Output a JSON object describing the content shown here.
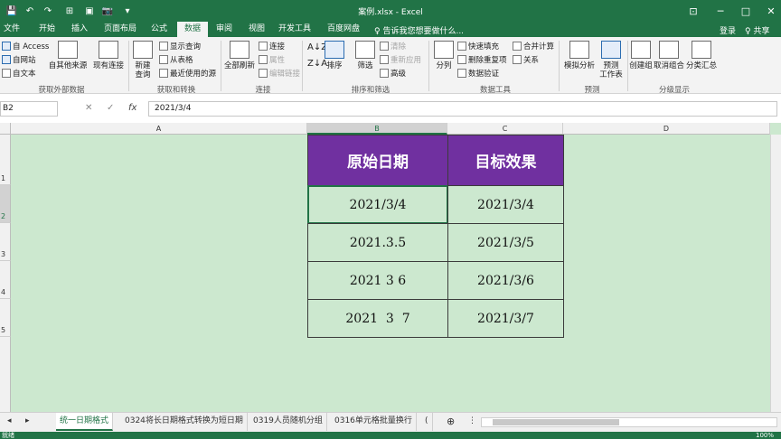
{
  "titlebar": {
    "title": "案例.xlsx - Excel",
    "minimize_icon": "─",
    "restore_icon": "□",
    "close_icon": "✕",
    "ribbon_display_icon": "⊡"
  },
  "quick_access": {
    "save_icon": "💾",
    "undo_icon": "↶",
    "redo_icon": "↷",
    "icons": [
      "⊞",
      "▣",
      "📷",
      "▾"
    ]
  },
  "tabs": [
    {
      "label": "文件"
    },
    {
      "label": "开始"
    },
    {
      "label": "插入"
    },
    {
      "label": "页面布局"
    },
    {
      "label": "公式"
    },
    {
      "label": "数据"
    },
    {
      "label": "审阅"
    },
    {
      "label": "视图"
    },
    {
      "label": "开发工具"
    },
    {
      "label": "百度网盘"
    }
  ],
  "tell_me": "♀ 告诉我您想要做什么...",
  "account": {
    "sign_in": "登录",
    "share": "♀ 共享"
  },
  "ribbon": {
    "get_external": {
      "access": "自 Access",
      "web": "自网站",
      "text": "自文本",
      "other": "自其他来源",
      "existing": "现有连接",
      "label": "获取外部数据"
    },
    "get_transform": {
      "new_query": "新建",
      "new_query2": "查询",
      "show_queries": "显示查询",
      "from_table": "从表格",
      "recent": "最近使用的源",
      "label": "获取和转换"
    },
    "connections": {
      "refresh_all": "全部刷新",
      "connections": "连接",
      "properties": "属性",
      "edit_links": "编辑链接",
      "label": "连接"
    },
    "sort_filter": {
      "sort": "排序",
      "filter": "筛选",
      "clear": "清除",
      "reapply": "重新应用",
      "advanced": "高级",
      "label": "排序和筛选"
    },
    "data_tools": {
      "split": "分列",
      "flash_fill": "快速填充",
      "remove_dup": "删除重复项",
      "validation": "数据验证",
      "consolidate": "合并计算",
      "relations": "关系",
      "label": "数据工具"
    },
    "forecast": {
      "what_if": "模拟分析",
      "forecast_sheet": "预测",
      "forecast_sheet2": "工作表",
      "label": "预测"
    },
    "outline": {
      "group": "创建组",
      "ungroup": "取消组合",
      "subtotal": "分类汇总",
      "label": "分级显示"
    }
  },
  "formula_bar": {
    "name_box": "B2",
    "cancel": "✕",
    "enter": "✓",
    "fx": "fx",
    "value": "2021/3/4"
  },
  "grid": {
    "columns": [
      "A",
      "B",
      "C",
      "D"
    ],
    "rows": [
      "1",
      "2",
      "3",
      "4",
      "5"
    ],
    "headers": {
      "original": "原始日期",
      "target": "目标效果"
    },
    "original": [
      "2021/3/4",
      "2021.3.5",
      "2021 3 6",
      "2021  3  7"
    ],
    "target": [
      "2021/3/4",
      "2021/3/5",
      "2021/3/6",
      "2021/3/7"
    ]
  },
  "sheets": [
    {
      "label": "统一日期格式"
    },
    {
      "label": "0324将长日期格式转换为短日期"
    },
    {
      "label": "0319人员随机分组"
    },
    {
      "label": "0316单元格批量换行"
    },
    {
      "label": "("
    }
  ],
  "status": {
    "ready": "就绪",
    "zoom": "100%"
  }
}
